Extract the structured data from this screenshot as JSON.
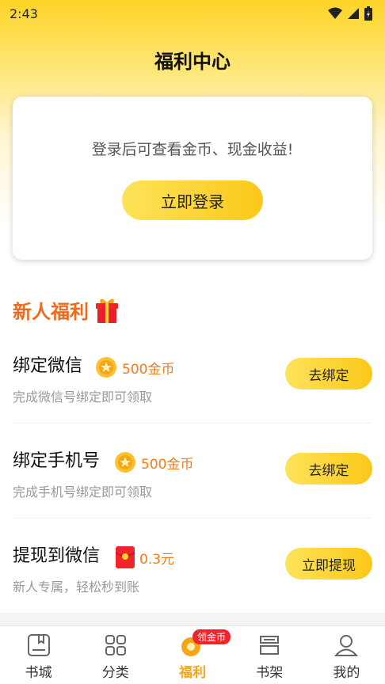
{
  "status_bar": {
    "time": "2:43"
  },
  "header": {
    "title": "福利中心"
  },
  "login_card": {
    "message": "登录后可查看金币、现金收益!",
    "button_label": "立即登录"
  },
  "new_user_section": {
    "title": "新人福利",
    "tasks": [
      {
        "name": "绑定微信",
        "reward": "500金币",
        "reward_icon": "coin-icon",
        "desc": "完成微信号绑定即可领取",
        "button": "去绑定"
      },
      {
        "name": "绑定手机号",
        "reward": "500金币",
        "reward_icon": "coin-icon",
        "desc": "完成手机号绑定即可领取",
        "button": "去绑定"
      },
      {
        "name": "提现到微信",
        "reward": "0.3元",
        "reward_icon": "red-packet-icon",
        "desc": "新人专属，轻松秒到账",
        "button": "立即提现"
      }
    ]
  },
  "tab_bar": {
    "tabs": [
      {
        "label": "书城",
        "icon": "bookstore-icon"
      },
      {
        "label": "分类",
        "icon": "category-grid-icon"
      },
      {
        "label": "福利",
        "icon": "coin-icon",
        "badge": "领金币",
        "active": true
      },
      {
        "label": "书架",
        "icon": "bookshelf-icon"
      },
      {
        "label": "我的",
        "icon": "profile-icon"
      }
    ]
  },
  "colors": {
    "accent_yellow": "#FCC818",
    "section_orange": "#F06A1A",
    "reward_orange": "#F07D1A",
    "active_tab": "#F5A516",
    "badge_red": "#F0242A"
  }
}
